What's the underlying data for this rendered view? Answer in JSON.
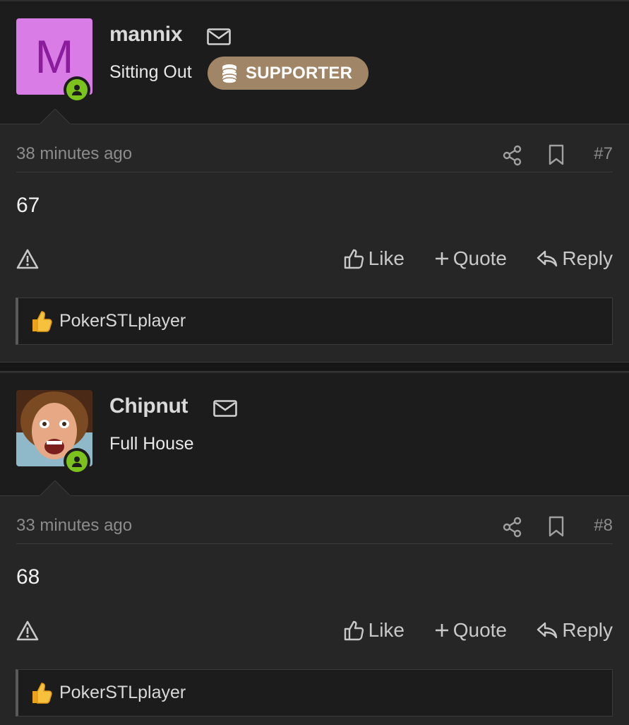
{
  "posts": [
    {
      "username": "mannix",
      "avatar_letter": "M",
      "avatar_bg": "#d97ce6",
      "user_title": "Sitting Out",
      "badge": "SUPPORTER",
      "timestamp": "38 minutes ago",
      "post_number": "#7",
      "content": "67",
      "actions": {
        "like": "Like",
        "quote": "Quote",
        "reply": "Reply"
      },
      "reaction_user": "PokerSTLplayer",
      "icons": [
        "mail-icon",
        "online-status-icon",
        "coins-icon",
        "share-icon",
        "bookmark-icon",
        "report-icon",
        "thumbs-up-icon",
        "plus-icon",
        "reply-arrow-icon"
      ]
    },
    {
      "username": "Chipnut",
      "user_title": "Full House",
      "timestamp": "33 minutes ago",
      "post_number": "#8",
      "content": "68",
      "actions": {
        "like": "Like",
        "quote": "Quote",
        "reply": "Reply"
      },
      "reaction_user": "PokerSTLplayer",
      "icons": [
        "mail-icon",
        "online-status-icon",
        "share-icon",
        "bookmark-icon",
        "report-icon",
        "thumbs-up-icon",
        "plus-icon",
        "reply-arrow-icon"
      ]
    }
  ],
  "colors": {
    "online_green": "#7cc21c",
    "badge_bg": "#a08566",
    "post_bg": "#262626",
    "header_bg": "#1c1c1c"
  }
}
